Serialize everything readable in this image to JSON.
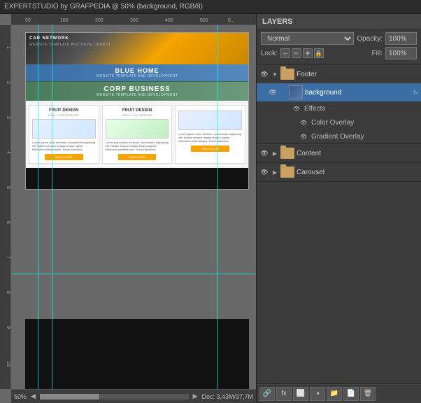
{
  "titlebar": {
    "title": "EXPERTSTUDIO by GRAFPEDIA @ 50% (background, RGB/8)"
  },
  "canvas": {
    "zoom": "50%",
    "doc_size": "Doc: 3,43M/37,7M"
  },
  "layers_panel": {
    "title": "LAYERS",
    "blend_mode": "Normal",
    "opacity_label": "Opacity:",
    "opacity_value": "100%",
    "lock_label": "Lock:",
    "fill_label": "Fill:",
    "fill_value": "100%",
    "layers": [
      {
        "id": "footer",
        "name": "Footer",
        "type": "group",
        "visible": true,
        "expanded": true,
        "children": [
          {
            "id": "background",
            "name": "background",
            "type": "layer",
            "visible": true,
            "selected": true,
            "has_fx": true,
            "effects": [
              {
                "id": "effects-label",
                "name": "Effects",
                "visible": true
              },
              {
                "id": "color-overlay",
                "name": "Color Overlay",
                "visible": true
              },
              {
                "id": "gradient-overlay",
                "name": "Gradient Overlay",
                "visible": true
              }
            ]
          }
        ]
      },
      {
        "id": "content",
        "name": "Content",
        "type": "group",
        "visible": true,
        "expanded": false
      },
      {
        "id": "carousel",
        "name": "Carousel",
        "type": "group",
        "visible": true,
        "expanded": false
      }
    ],
    "toolbar_buttons": [
      "link-icon",
      "fx-icon",
      "mask-icon",
      "adjustment-icon",
      "new-group-icon",
      "new-layer-icon",
      "delete-icon"
    ]
  },
  "mockup": {
    "header_nav": "CAR NETWORK",
    "header_sub": "WEBSITE TEMPLATE AND DEVELOPMENT",
    "blue_home_title": "BLUE HOME",
    "blue_home_sub": "WEBSITE TEMPLATE AND DEVELOPMENT",
    "corp_business_title": "CORP BUSINESS",
    "corp_business_sub": "WEBSITE TEMPLATE AND DEVELOPMENT",
    "card1_title": "FRUIT DESIGN",
    "card1_sub": "HTML / CSS TEMPLATE",
    "card2_title": "FRUIT DESIGN",
    "card2_sub": "HTML / CSS TEMPLATE",
    "card3_sub": "",
    "card_text": "Lorem ipsum dolor sit amet, consectetur adipiscing elit. Nullam tempus massa tempor sapien bibendum pellentesque. Donec faucibus.",
    "card_btn": "READ MORE"
  }
}
